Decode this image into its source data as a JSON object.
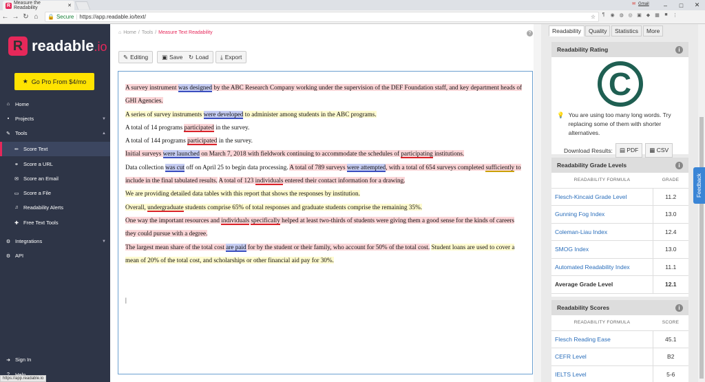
{
  "browser": {
    "tab_title": "Measure the Readability",
    "url": "https://app.readable.io/text/",
    "secure_label": "Secure",
    "gmail_label": "Gmail"
  },
  "sidebar": {
    "logo": "readable",
    "logo_suffix": ".io",
    "gopro": "Go Pro From $4/mo",
    "items": [
      {
        "label": "Home",
        "icon": "home-icon"
      },
      {
        "label": "Projects",
        "icon": "briefcase-icon"
      },
      {
        "label": "Tools",
        "icon": "wrench-icon"
      },
      {
        "label": "Score Text",
        "icon": "pencil-icon"
      },
      {
        "label": "Score a URL",
        "icon": "link-icon"
      },
      {
        "label": "Score an Email",
        "icon": "envelope-icon"
      },
      {
        "label": "Score a File",
        "icon": "file-icon"
      },
      {
        "label": "Readability Alerts",
        "icon": "bell-icon"
      },
      {
        "label": "Free Text Tools",
        "icon": "gift-icon"
      },
      {
        "label": "Integrations",
        "icon": "gear-icon"
      },
      {
        "label": "API",
        "icon": "api-icon"
      },
      {
        "label": "Sign In",
        "icon": "signin-icon"
      },
      {
        "label": "Help",
        "icon": "help-icon"
      }
    ]
  },
  "breadcrumb": {
    "home": "Home",
    "tools": "Tools",
    "current": "Measure Text Readability"
  },
  "toolbar": {
    "editing": "Editing",
    "save": "Save",
    "load": "Load",
    "export": "Export"
  },
  "status_url": "https://app.readable.io",
  "right": {
    "tabs": [
      "Readability",
      "Quality",
      "Statistics",
      "More"
    ],
    "rating": {
      "title": "Readability Rating",
      "grade": "C",
      "tip": "You are using too many long words. Try replacing some of them with shorter alternatives.",
      "download_label": "Download Results:",
      "pdf": "PDF",
      "csv": "CSV"
    },
    "grade_levels": {
      "title": "Readability Grade Levels",
      "col1": "READABILITY FORMULA",
      "col2": "GRADE",
      "rows": [
        [
          "Flesch-Kincaid Grade Level",
          "11.2"
        ],
        [
          "Gunning Fog Index",
          "13.0"
        ],
        [
          "Coleman-Liau Index",
          "12.4"
        ],
        [
          "SMOG Index",
          "13.0"
        ],
        [
          "Automated Readability Index",
          "11.1"
        ]
      ],
      "avg_label": "Average Grade Level",
      "avg_value": "12.1"
    },
    "scores": {
      "title": "Readability Scores",
      "col1": "READABILITY FORMULA",
      "col2": "SCORE",
      "rows": [
        [
          "Flesch Reading Ease",
          "45.1"
        ],
        [
          "CEFR Level",
          "B2"
        ],
        [
          "IELTS Level",
          "5-6"
        ]
      ]
    },
    "feedback": "Feedback"
  }
}
